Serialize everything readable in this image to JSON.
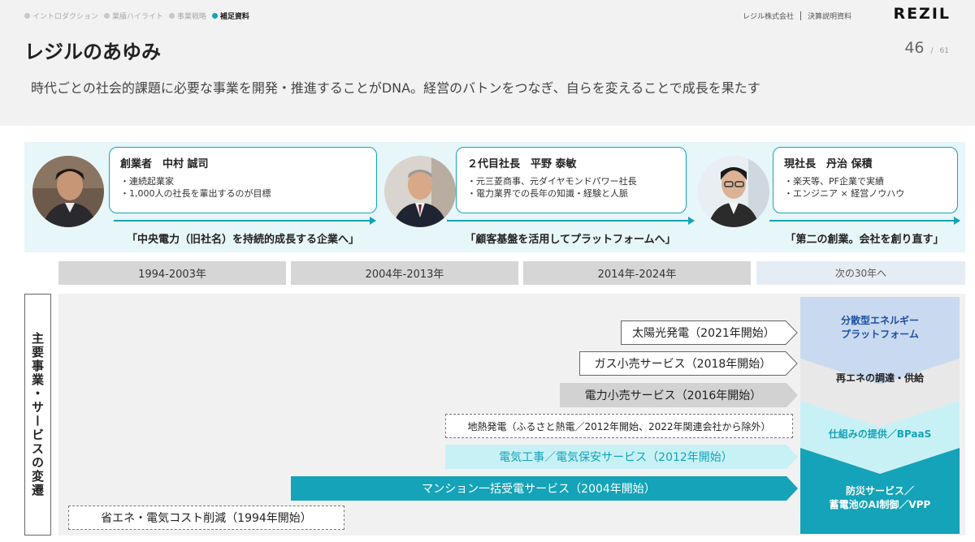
{
  "nav": {
    "items": [
      {
        "label": "イントロダクション",
        "active": false
      },
      {
        "label": "業績ハイライト",
        "active": false
      },
      {
        "label": "事業戦略",
        "active": false
      },
      {
        "label": "補足資料",
        "active": true
      }
    ]
  },
  "header": {
    "company": "レジル株式会社",
    "doc_type": "決算説明資料",
    "logo": "REZIL",
    "title": "レジルのあゆみ",
    "page_current": "46",
    "page_sep": "/",
    "page_total": "61",
    "subtitle": "時代ごとの社会的課題に必要な事業を開発・推進することがDNA。経営のバトンをつなぎ、自らを変えることで成長を果たす"
  },
  "leaders": [
    {
      "name": "創業者　中村 誠司",
      "points": [
        "・連続起業家",
        "・1,000人の社長を輩出するのが目標"
      ],
      "slogan": "「中央電力（旧社名）を持続的成長する企業へ」"
    },
    {
      "name": "２代目社長　平野 泰敏",
      "points": [
        "・元三菱商事、元ダイヤモンドパワー社長",
        "・電力業界での長年の知識・経験と人脈"
      ],
      "slogan": "「顧客基盤を活用してプラットフォームへ」"
    },
    {
      "name": "現社長　丹治 保積",
      "points": [
        "・楽天等、PF企業で実績",
        "・エンジニア × 経営ノウハウ"
      ],
      "slogan": "「第二の創業。会社を創り直す」"
    }
  ],
  "periods": [
    "1994-2003年",
    "2004年-2013年",
    "2014年-2024年",
    "次の30年へ"
  ],
  "vertical_label": "主要事業・サービスの変遷",
  "businesses": {
    "solar": "太陽光発電（2021年開始）",
    "gas": "ガス小売サービス（2018年開始）",
    "power_retail": "電力小売サービス（2016年開始）",
    "geothermal": "地熱発電（ふるさと熱電／2012年開始、2022年関連会社から除外）",
    "electrical": "電気工事／電気保安サービス（2012年開始）",
    "mansion": "マンション一括受電サービス（2004年開始）",
    "energy_saving": "省エネ・電気コスト削減（1994年開始）"
  },
  "future": {
    "layer1": "分散型エネルギー\nプラットフォーム",
    "layer2": "再エネの調達・供給",
    "layer3": "仕組みの提供／BPaaS",
    "layer4": "防災サービス／\n蓄電池のAI制御／VPP",
    "colors": [
      "#c9daf0",
      "#e8e8e8",
      "#c8f1f6",
      "#14a3b8"
    ]
  },
  "colors": {
    "accent": "#14a3b8",
    "light_accent": "#c8f1f6",
    "gray_bar": "#d2d2d2"
  }
}
